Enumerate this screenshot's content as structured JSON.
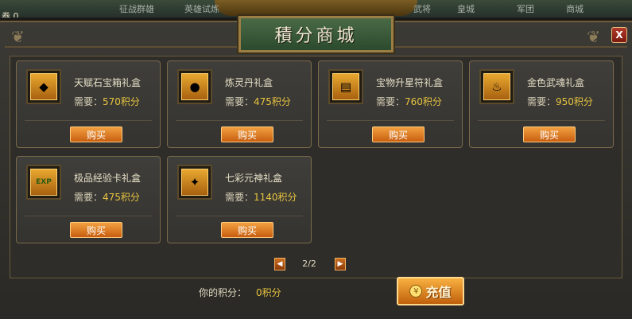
{
  "topbar": {
    "left_label": "券 0",
    "hints": [
      "征战群雄",
      "英雄试炼",
      "武将",
      "皇城",
      "军团",
      "商城"
    ]
  },
  "window": {
    "title": "積分商城",
    "close_label": "X"
  },
  "common": {
    "need_label": "需要：",
    "buy_label": "购买"
  },
  "items": [
    {
      "name": "天赋石宝箱礼盒",
      "cost": "570积分",
      "icon": "gem-icon",
      "glyph": "◆"
    },
    {
      "name": "炼灵丹礼盒",
      "cost": "475积分",
      "icon": "pill-icon",
      "glyph": "●"
    },
    {
      "name": "宝物升星符礼盒",
      "cost": "760积分",
      "icon": "talisman-icon",
      "glyph": "▤"
    },
    {
      "name": "金色武魂礼盒",
      "cost": "950积分",
      "icon": "flame-icon",
      "glyph": "♨"
    },
    {
      "name": "极品经验卡礼盒",
      "cost": "475积分",
      "icon": "exp-card-icon",
      "glyph": "EXP"
    },
    {
      "name": "七彩元神礼盒",
      "cost": "1140积分",
      "icon": "spirit-orb-icon",
      "glyph": "✦"
    }
  ],
  "pager": {
    "text": "2/2"
  },
  "footer": {
    "score_label": "你的积分：",
    "score_value": "0积分",
    "recharge_label": "充值"
  },
  "colors": {
    "accent": "#e8c440",
    "button": "#e07a1e",
    "frame": "#9a7e44"
  }
}
